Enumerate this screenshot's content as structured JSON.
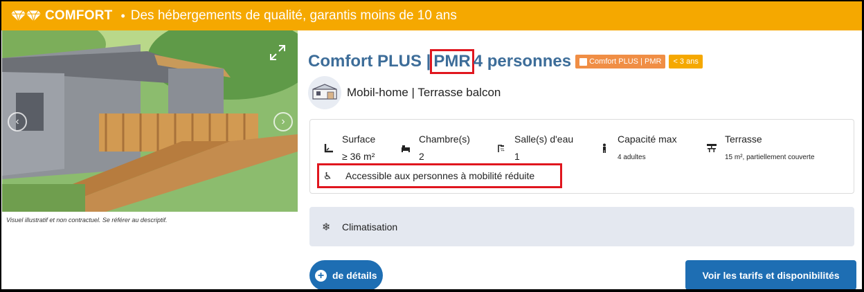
{
  "banner": {
    "brand": "COMFORT",
    "separator": "•",
    "tagline": "Des hébergements de qualité, garantis moins de 10 ans",
    "icon": "diamonds-icon",
    "color": "#f5a800"
  },
  "photo": {
    "caption": "Visuel illustratif et non contractuel. Se référer au descriptif."
  },
  "title": {
    "prefix": "Comfort PLUS |",
    "pmr": "PMR",
    "suffix": "4 personnes",
    "color": "#3d6d99",
    "badges": [
      "Comfort PLUS | PMR",
      "< 3 ans"
    ]
  },
  "type": {
    "label": "Mobil-home | Terrasse balcon",
    "icon": "mobile-home-icon"
  },
  "specs": [
    {
      "label": "Surface",
      "value": "≥ 36 m²",
      "icon": "surface-icon"
    },
    {
      "label": "Chambre(s)",
      "value": "2",
      "icon": "bed-icon"
    },
    {
      "label": "Salle(s) d'eau",
      "value": "1",
      "icon": "shower-icon"
    },
    {
      "label": "Capacité max",
      "value": "4 adultes",
      "icon": "person-icon"
    },
    {
      "label": "Terrasse",
      "value": "15 m², partiellement couverte",
      "icon": "terrace-icon"
    }
  ],
  "accessibility": {
    "text": "Accessible aux personnes à mobilité réduite",
    "icon": "wheelchair-icon"
  },
  "equipment": {
    "text": "Climatisation",
    "icon": "snowflake-icon"
  },
  "buttons": {
    "details": "de détails",
    "tarifs": "Voir les tarifs et disponibilités",
    "color": "#1e6eb3"
  }
}
